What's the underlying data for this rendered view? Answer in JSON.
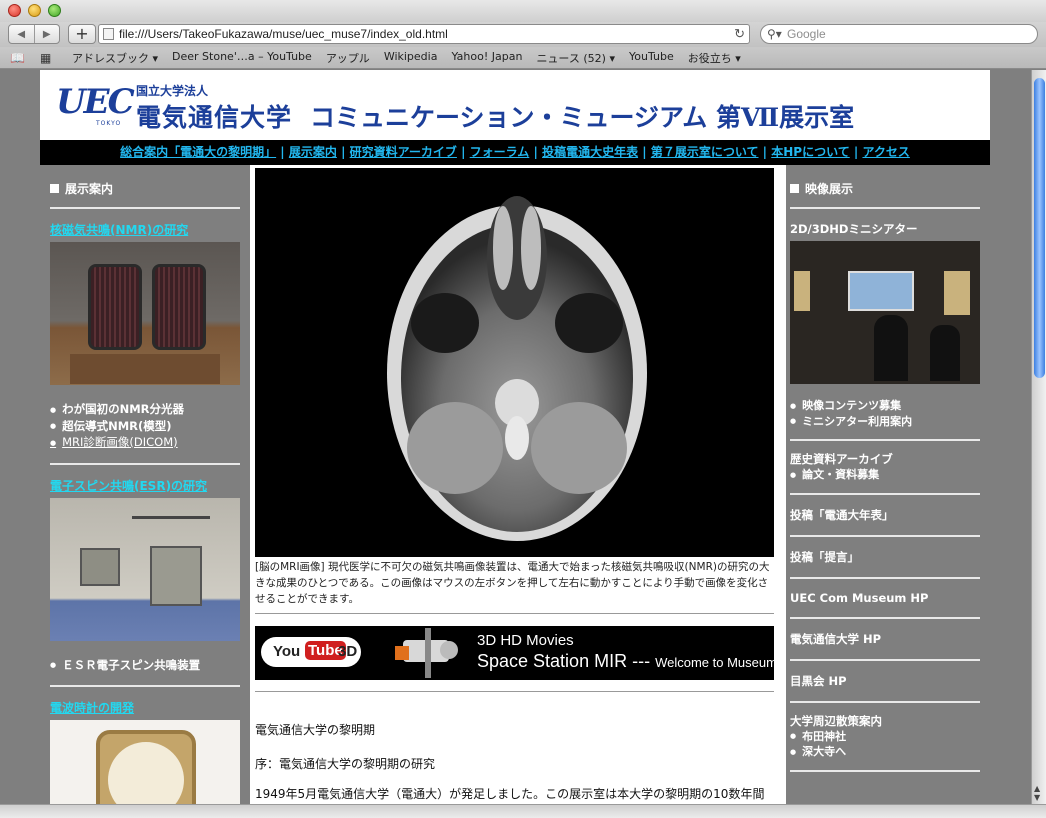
{
  "browser": {
    "url": "file:///Users/TakeoFukazawa/muse/uec_muse7/index_old.html",
    "search_placeholder": "Google",
    "bookmarks": [
      "アドレスブック ▾",
      "Deer Stone'…a – YouTube",
      "アップル",
      "Wikipedia",
      "Yahoo! Japan",
      "ニュース (52) ▾",
      "YouTube",
      "お役立ち ▾"
    ]
  },
  "header": {
    "logo_text": "UEC",
    "logo_sub": "TOKYO",
    "kokuritsu": "国立大学法人",
    "university": "電気通信大学",
    "museum": "コミュニケーション・ミュージアム 第Ⅶ展示室"
  },
  "topnav": [
    "総合案内「電通大の黎明期」",
    "展示案内",
    "研究資料アーカイブ",
    "フォーラム",
    "投稿電通大史年表",
    "第７展示室について",
    "本HPについて",
    "アクセス"
  ],
  "left": {
    "heading": "展示案内",
    "nmr_title": "核磁気共鳴(NMR)の研究",
    "nmr_items": [
      "わが国初のNMR分光器",
      "超伝導式NMR(模型)"
    ],
    "nmr_link": "MRI診断画像(DICOM)",
    "esr_title": "電子スピン共鳴(ESR)の研究",
    "esr_items": [
      "ＥＳＲ電子スピン共鳴装置"
    ],
    "clock_title": "電波時計の開発"
  },
  "center": {
    "caption": "[脳のMRI画像] 現代医学に不可欠の磁気共鳴画像装置は、電通大で始まった核磁気共鳴吸収(NMR)の研究の大きな成果のひとつである。この画像はマウスの左ボタンを押して左右に動かすことにより手動で画像を変化させることができます。",
    "banner_you": "You",
    "banner_tube": "Tube",
    "banner_3d": "3D",
    "banner_line1": "3D HD Movies",
    "banner_line2": "Space Station MIR --- ",
    "banner_line2_small": "Welcome to Museum",
    "section_title": "電気通信大学の黎明期",
    "preface": "序：電気通信大学の黎明期の研究",
    "body": "1949年5月電気通信大学（電通大）が発足しました。この展示室は本大学の黎明期の10数年間"
  },
  "right": {
    "heading": "映像展示",
    "theater_title": "2D/3DHDミニシアター",
    "theater_items": [
      "映像コンテンツ募集",
      "ミニシアター利用案内"
    ],
    "archive_title": "歴史資料アーカイブ",
    "archive_items": [
      "論文・資料募集"
    ],
    "links": [
      "投稿「電通大年表」",
      "投稿「提言」",
      "UEC Com Museum HP",
      "電気通信大学 HP",
      "目黒会 HP"
    ],
    "walk_title": "大学周辺散策案内",
    "walk_items": [
      "布田神社",
      "深大寺へ"
    ]
  }
}
